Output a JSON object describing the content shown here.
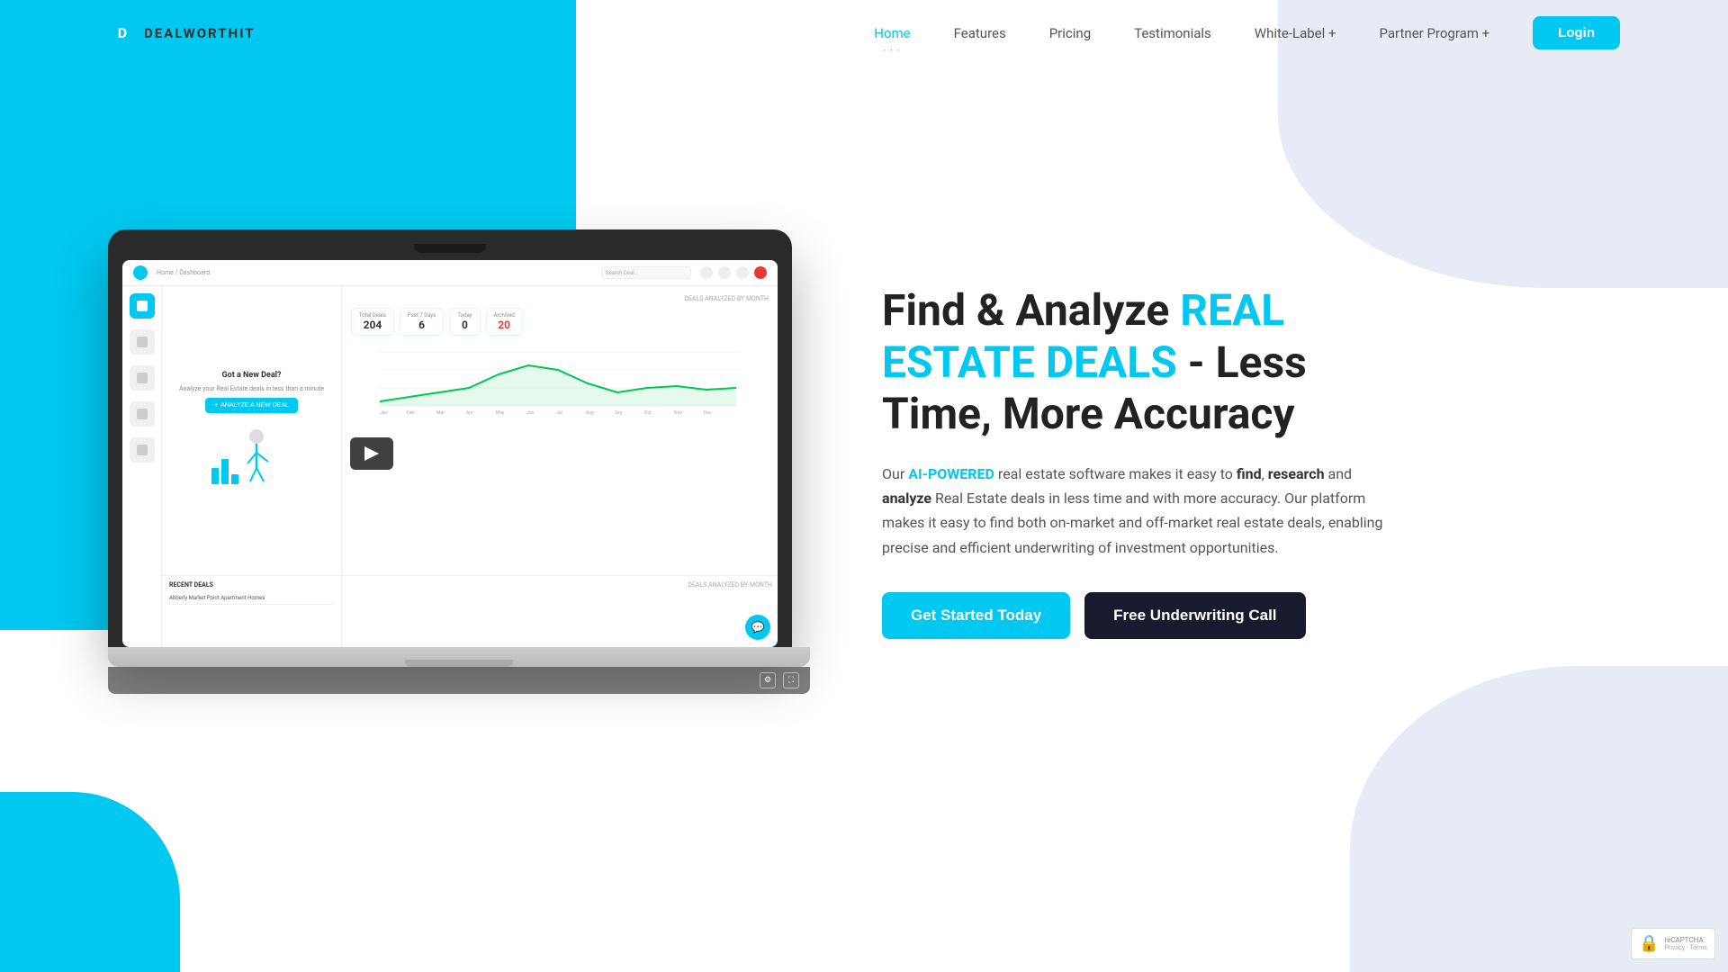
{
  "brand": {
    "name": "DEALWORTHIT",
    "logo_letter": "D"
  },
  "nav": {
    "items": [
      {
        "label": "Home",
        "active": true,
        "has_dropdown": false
      },
      {
        "label": "Features",
        "active": false,
        "has_dropdown": false
      },
      {
        "label": "Pricing",
        "active": false,
        "has_dropdown": false
      },
      {
        "label": "Testimonials",
        "active": false,
        "has_dropdown": false
      },
      {
        "label": "White-Label +",
        "active": false,
        "has_dropdown": true
      },
      {
        "label": "Partner Program +",
        "active": false,
        "has_dropdown": true
      }
    ],
    "login_label": "Login"
  },
  "hero": {
    "title_part1": "Find & Analyze ",
    "title_accent": "REAL ESTATE DEALS",
    "title_part2": " - Less Time, More Accuracy",
    "description_prefix": "Our ",
    "description_highlight": "AI-POWERED",
    "description_suffix": " real estate software makes it easy to ",
    "find": "find",
    "comma": ", ",
    "research": "research",
    "and": " and ",
    "analyze": "analyze",
    "description_end": " Real Estate deals in less time and with more accuracy. Our platform makes it easy to find both on-market and off-market real estate deals, enabling precise and efficient underwriting of investment opportunities.",
    "cta_primary": "Get Started Today",
    "cta_secondary": "Free Underwriting Call"
  },
  "dashboard": {
    "breadcrumb": "Home / Dashboard",
    "search_placeholder": "Search Deal...",
    "stats": [
      {
        "label": "Total Deals",
        "value": "204"
      },
      {
        "label": "Past 7 Days",
        "value": "6"
      },
      {
        "label": "Today",
        "value": "0"
      },
      {
        "label": "Archived",
        "value": "20"
      }
    ],
    "new_deal_title": "Got a New Deal?",
    "new_deal_subtitle": "Analyze your Real Estate deals in less than a minute",
    "analyze_btn": "ANALYZE A NEW DEAL",
    "chart_label": "DEALS ANALYZED BY MONTH",
    "chart_months": [
      "Jan",
      "Feb",
      "Mar",
      "Apr",
      "May",
      "Jun",
      "Jul",
      "Aug",
      "Sep",
      "Oct",
      "Nov",
      "Dec"
    ],
    "recent_deals_label": "RECENT DEALS",
    "deal_name": "Abberly Market Point Apartment Homes"
  },
  "recaptcha": {
    "text": "reCAPTCHA",
    "subtext": "Privacy - Terms"
  }
}
